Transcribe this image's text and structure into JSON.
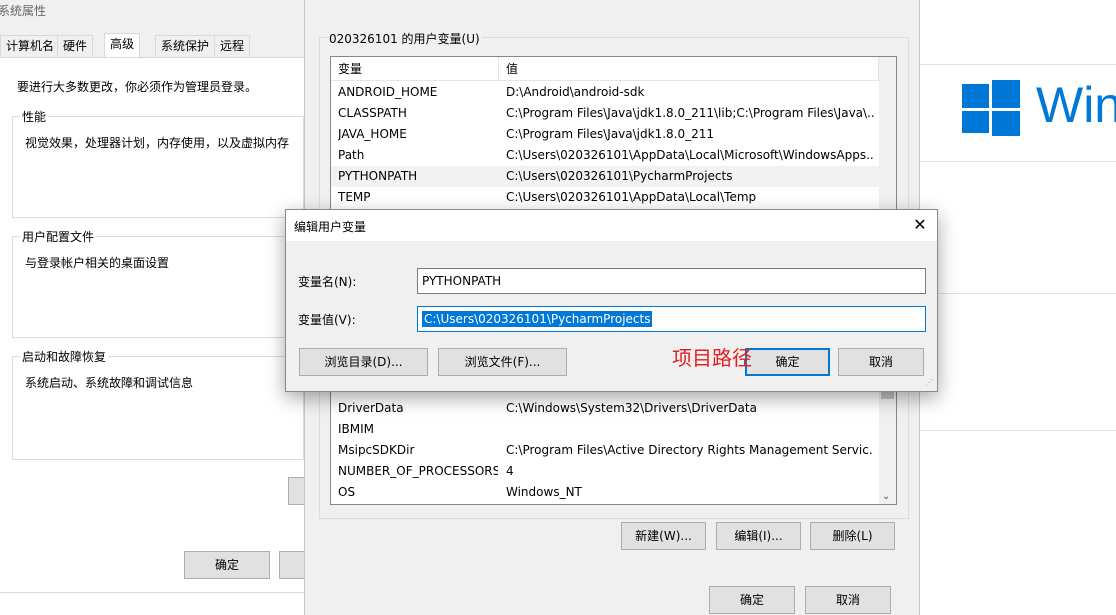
{
  "background": {
    "logo_text": "Win"
  },
  "sysprops": {
    "title": "系统属性",
    "tabs": [
      "计算机名",
      "硬件",
      "高级",
      "系统保护",
      "远程"
    ],
    "admin_note": "要进行大多数更改，你必须作为管理员登录。",
    "groups": [
      {
        "title": "性能",
        "desc": "视觉效果，处理器计划，内存使用，以及虚拟内存"
      },
      {
        "title": "用户配置文件",
        "desc": "与登录帐户相关的桌面设置"
      },
      {
        "title": "启动和故障恢复",
        "desc": "系统启动、系统故障和调试信息"
      }
    ],
    "ok_button": "确定"
  },
  "envwin": {
    "user_vars_title": "020326101 的用户变量(U)",
    "columns": [
      "变量",
      "值"
    ],
    "rows": [
      {
        "name": "ANDROID_HOME",
        "value": "D:\\Android\\android-sdk"
      },
      {
        "name": "CLASSPATH",
        "value": "C:\\Program Files\\Java\\jdk1.8.0_211\\lib;C:\\Program Files\\Java\\..."
      },
      {
        "name": "JAVA_HOME",
        "value": "C:\\Program Files\\Java\\jdk1.8.0_211"
      },
      {
        "name": "Path",
        "value": "C:\\Users\\020326101\\AppData\\Local\\Microsoft\\WindowsApps..."
      },
      {
        "name": "PYTHONPATH",
        "value": "C:\\Users\\020326101\\PycharmProjects"
      },
      {
        "name": "TEMP",
        "value": "C:\\Users\\020326101\\AppData\\Local\\Temp"
      }
    ],
    "system_rows": [
      {
        "name": "DriverData",
        "value": "C:\\Windows\\System32\\Drivers\\DriverData"
      },
      {
        "name": "IBMIM",
        "value": ""
      },
      {
        "name": "MsipcSDKDir",
        "value": "C:\\Program Files\\Active Directory Rights Management Servic..."
      },
      {
        "name": "NUMBER_OF_PROCESSORS",
        "value": "4"
      },
      {
        "name": "OS",
        "value": "Windows_NT"
      }
    ],
    "new_button": "新建(W)...",
    "edit_button": "编辑(I)...",
    "delete_button": "删除(L)",
    "ok_button": "确定",
    "cancel_button": "取消"
  },
  "dialog": {
    "title": "编辑用户变量",
    "close_glyph": "✕",
    "name_label": "变量名(N):",
    "name_value": "PYTHONPATH",
    "value_label": "变量值(V):",
    "value_value": "C:\\Users\\020326101\\PycharmProjects",
    "browse_dir_button": "浏览目录(D)...",
    "browse_file_button": "浏览文件(F)...",
    "ok_button": "确定",
    "cancel_button": "取消"
  },
  "annotation": "项目路径",
  "colors": {
    "accent": "#0078d7",
    "annotation": "#e02020"
  }
}
